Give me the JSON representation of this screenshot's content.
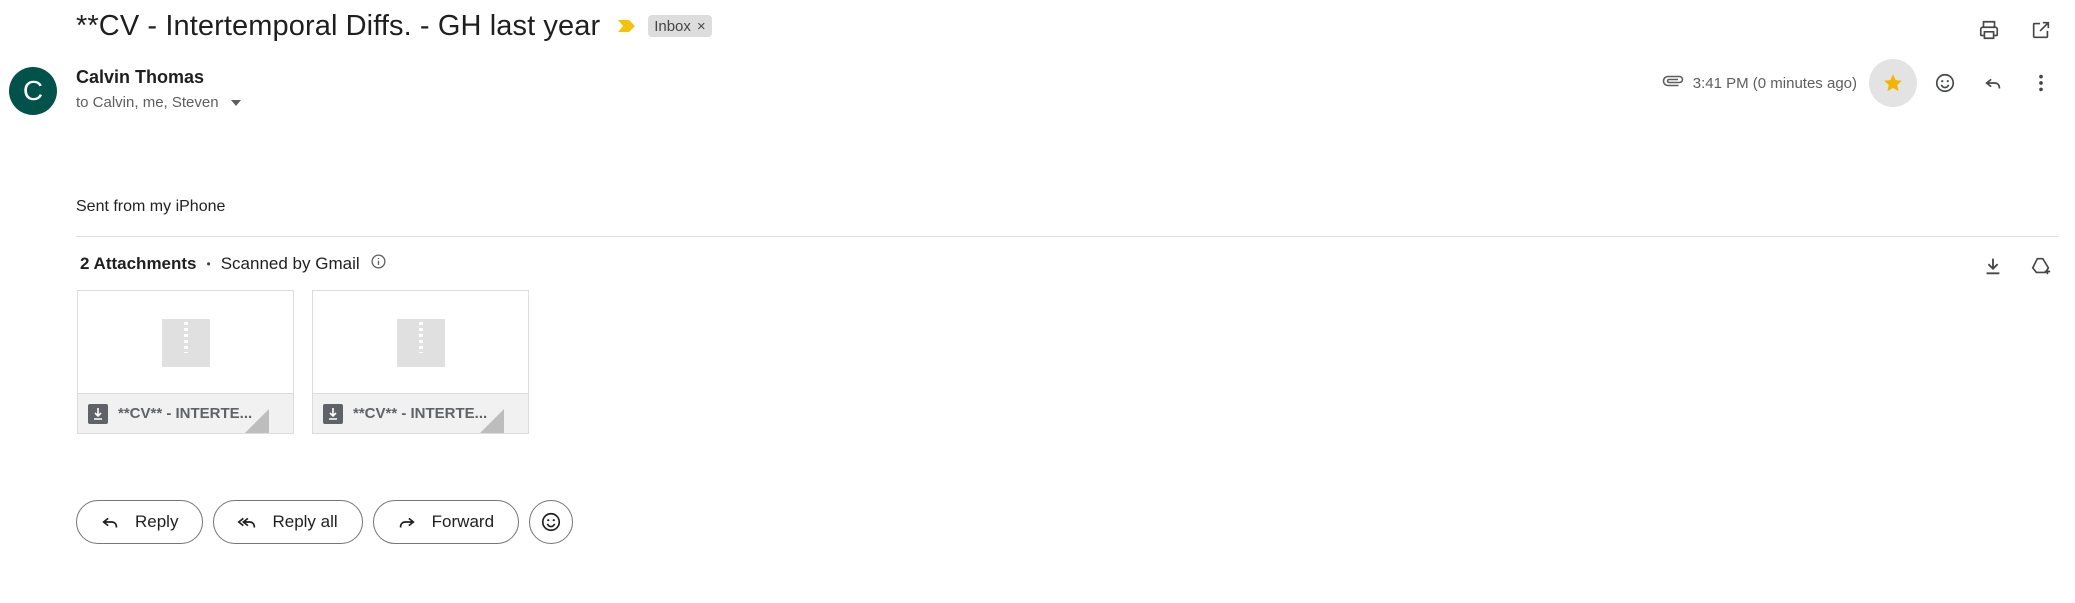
{
  "subject": "**CV - Intertemporal Diffs. - GH last year",
  "label": {
    "name": "Inbox",
    "remove": "×"
  },
  "sender": {
    "initial": "C",
    "name": "Calvin Thomas",
    "avatar_color": "#00524a"
  },
  "recipients": "to Calvin, me, Steven",
  "timestamp": "3:41 PM (0 minutes ago)",
  "body": "Sent from my iPhone",
  "attachments_header": {
    "count": "2 Attachments",
    "separator": "•",
    "scanned": "Scanned by Gmail"
  },
  "attachments": [
    {
      "name": "**CV** - INTERTE...",
      "icon": "zip-file-icon"
    },
    {
      "name": "**CV** - INTERTE...",
      "icon": "zip-file-icon"
    }
  ],
  "actions": {
    "reply": "Reply",
    "reply_all": "Reply all",
    "forward": "Forward"
  },
  "colors": {
    "importance": "#f4c20d",
    "star": "#f4b400",
    "avatar": "#00524a"
  }
}
